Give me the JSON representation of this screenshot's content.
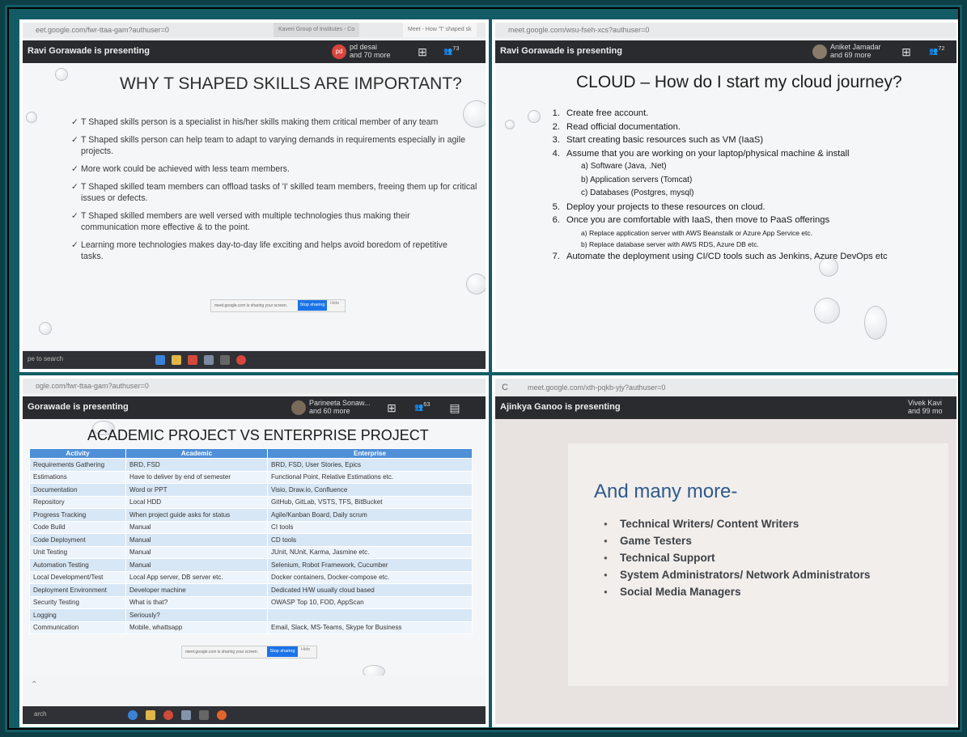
{
  "panel1": {
    "url": "eet.google.com/fwr-ttaa-gam?authuser=0",
    "tabs": [
      "Kaveri Group of Institutes - Co",
      "Meet - How 'T' shaped sk"
    ],
    "presenter": "Ravi Gorawade is presenting",
    "participants_avatar": "pd",
    "participants_name": "pd desai",
    "participants_more": "and 70 more",
    "people_count": "73",
    "slide_title": "WHY T SHAPED SKILLS ARE IMPORTANT?",
    "bullets": [
      "T Shaped skills person is a specialist in his/her skills making them critical member of any team",
      "T Shaped skills person can help team to adapt to varying demands in requirements especially in agile projects.",
      "More work could be achieved with less team members.",
      "T Shaped skilled team members can offload tasks of 'I' skilled team members, freeing them up for critical issues or defects.",
      "T Shaped skilled members are well versed with multiple technologies thus making their communication more effective & to the point.",
      "Learning more technologies makes day-to-day life exciting and helps avoid boredom of repetitive tasks."
    ],
    "share_notice": "meet.google.com is sharing your screen.",
    "stop_sharing": "Stop sharing",
    "hide": "Hide",
    "search_hint": "pe to search"
  },
  "panel2": {
    "url": "meet.google.com/wsu-fseh-xcs?authuser=0",
    "presenter": "Ravi Gorawade is presenting",
    "participants_name": "Aniket Jamadar",
    "participants_more": "and 69 more",
    "people_count": "72",
    "slide_title": "CLOUD – How do I start my cloud journey?",
    "steps": [
      {
        "num": "1.",
        "text": "Create free account."
      },
      {
        "num": "2.",
        "text": "Read official documentation."
      },
      {
        "num": "3.",
        "text": "Start creating basic resources such as VM (IaaS)"
      },
      {
        "num": "4.",
        "text": "Assume that you are working on your laptop/physical machine & install"
      },
      {
        "num": "a)",
        "text": "Software (Java, .Net)",
        "sub": true
      },
      {
        "num": "b)",
        "text": "Application servers (Tomcat)",
        "sub": true
      },
      {
        "num": "c)",
        "text": "Databases (Postgres, mysql)",
        "sub": true
      },
      {
        "num": "5.",
        "text": "Deploy your projects to these resources on cloud."
      },
      {
        "num": "6.",
        "text": "Once you are comfortable with IaaS, then move to PaaS offerings"
      },
      {
        "num": "a)",
        "text": "Replace application server with AWS Beanstalk or Azure App Service etc.",
        "sub": true,
        "small": true
      },
      {
        "num": "b)",
        "text": "Replace database server with AWS RDS, Azure DB etc.",
        "sub": true,
        "small": true
      },
      {
        "num": "7.",
        "text": "Automate the deployment using CI/CD tools such as Jenkins, Azure DevOps etc"
      }
    ]
  },
  "panel3": {
    "url": "ogle.com/fwr-ttaa-gam?authuser=0",
    "presenter": "Gorawade is presenting",
    "participants_name": "Parineeta Sonaw...",
    "participants_more": "and 60 more",
    "people_count": "63",
    "slide_title": "ACADEMIC PROJECT VS ENTERPRISE PROJECT",
    "headers": [
      "Activity",
      "Academic",
      "Enterprise"
    ],
    "rows": [
      [
        "Requirements Gathering",
        "BRD, FSD",
        "BRD, FSD, User Stories, Epics"
      ],
      [
        "Estimations",
        "Have to deliver by end of semester",
        "Functional Point, Relative Estimations etc."
      ],
      [
        "Documentation",
        "Word or PPT",
        "Visio, Draw.io, Confluence"
      ],
      [
        "Repository",
        "Local HDD",
        "GitHub, GitLab, VSTS, TFS, BitBucket"
      ],
      [
        "Progress Tracking",
        "When project guide asks for status",
        "Agile/Kanban Board, Daily scrum"
      ],
      [
        "Code Build",
        "Manual",
        "CI tools"
      ],
      [
        "Code Deployment",
        "Manual",
        "CD tools"
      ],
      [
        "Unit Testing",
        "Manual",
        "JUnit, NUnit, Karma, Jasmine etc."
      ],
      [
        "Automation Testing",
        "Manual",
        "Selenium, Robot Framework, Cucumber"
      ],
      [
        "Local Development/Test",
        "Local App server, DB server etc.",
        "Docker containers, Docker-compose etc."
      ],
      [
        "Deployment Environment",
        "Developer machine",
        "Dedicated H/W usually cloud based"
      ],
      [
        "Security Testing",
        "What is that?",
        "OWASP Top 10, FOD, AppScan"
      ],
      [
        "Logging",
        "Seriously?",
        ""
      ],
      [
        "Communication",
        "Mobile, whattsapp",
        "Email, Slack, MS-Teams, Skype for Business"
      ]
    ],
    "share_notice": "meet.google.com is sharing your screen.",
    "stop_sharing": "Stop sharing",
    "hide": "Hide",
    "search_hint": "arch"
  },
  "panel4": {
    "url": "meet.google.com/xth-pqkb-yjy?authuser=0",
    "presenter": "Ajinkya Ganoo is presenting",
    "participants_name": "Vivek Kavi",
    "participants_more": "and 99 mo",
    "slide_title": "And many more-",
    "items": [
      "Technical Writers/ Content Writers",
      "Game Testers",
      "Technical Support",
      "System Administrators/ Network Administrators",
      "Social Media Managers"
    ]
  }
}
